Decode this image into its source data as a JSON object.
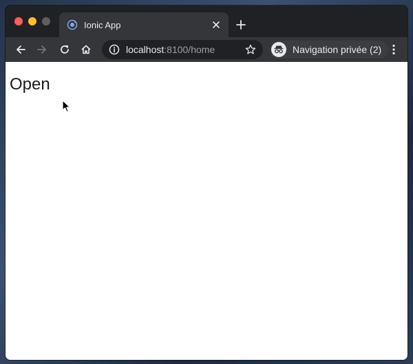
{
  "browser": {
    "tab": {
      "title": "Ionic App",
      "favicon": "ionic-logo-icon"
    },
    "toolbar": {
      "url_host": "localhost",
      "url_rest": ":8100/home",
      "incognito_label": "Navigation privée (2)"
    },
    "colors": {
      "frame": "#202124",
      "toolbar": "#35363a",
      "close": "#fe5f57",
      "minimize": "#febc2e"
    }
  },
  "page": {
    "heading": "Open"
  }
}
